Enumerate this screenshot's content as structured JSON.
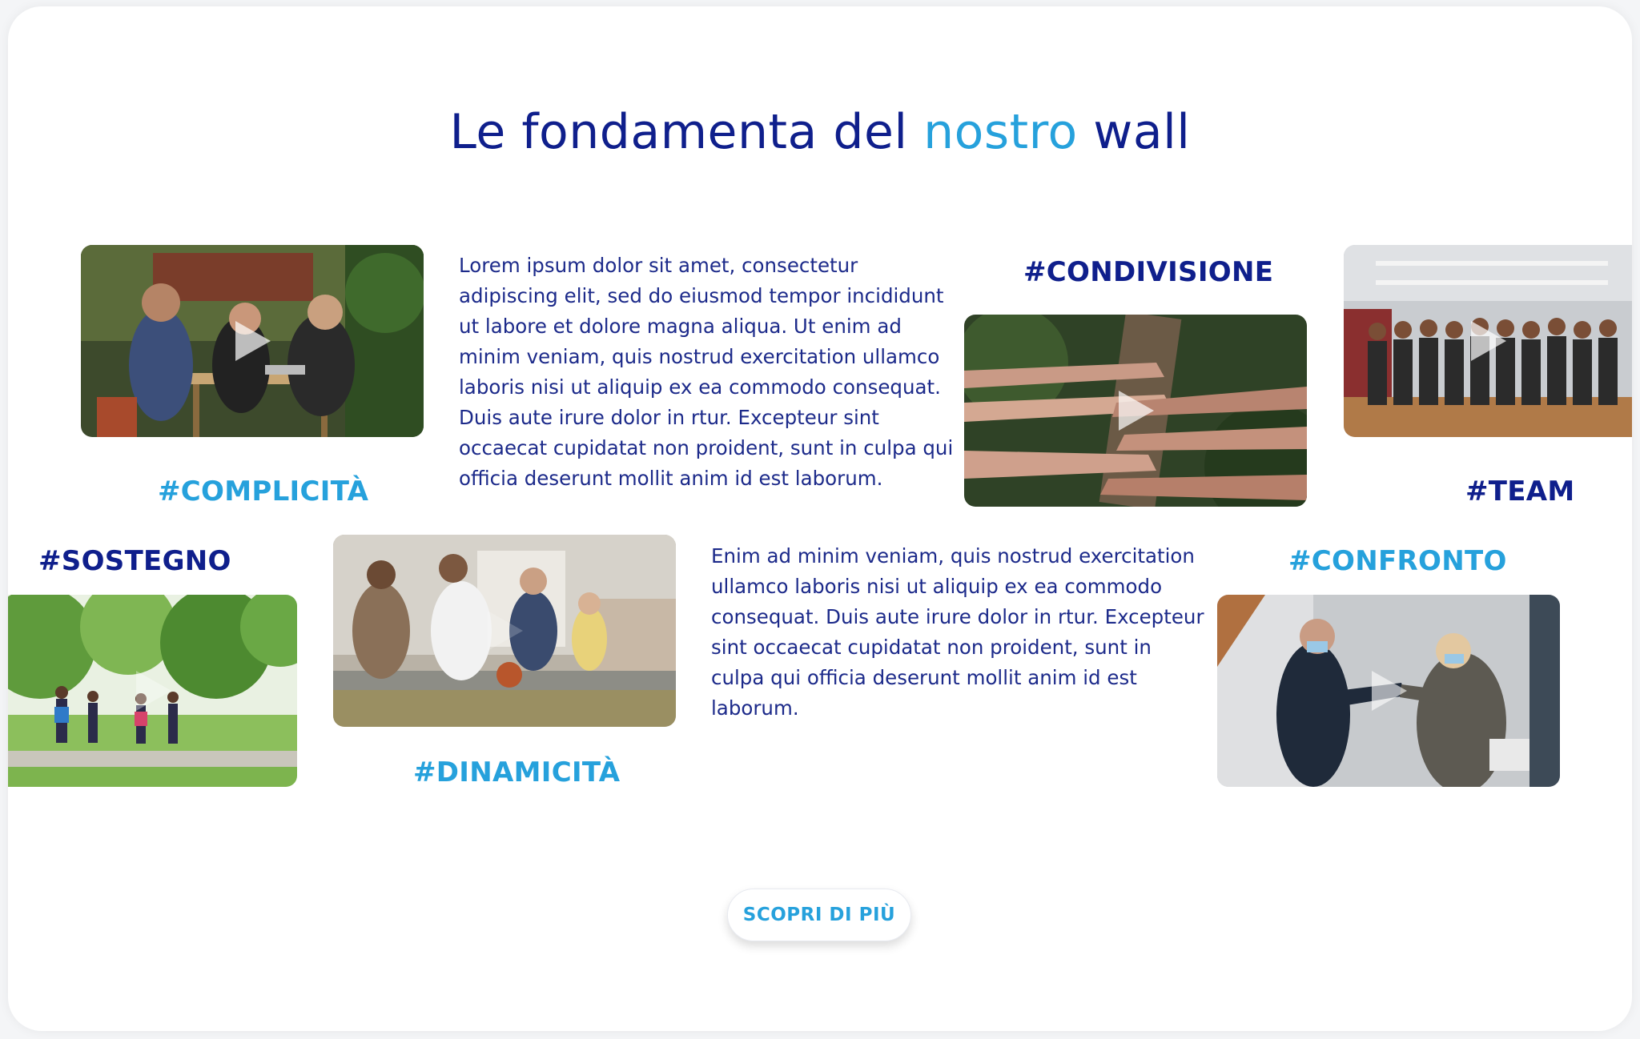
{
  "section": {
    "title_part1": "Le fondamenta del ",
    "title_accent": "nostro",
    "title_part2": " wall"
  },
  "tags": {
    "complicita": "#COMPLICITÀ",
    "condivisione": "#CONDIVISIONE",
    "team": "#TEAM",
    "sostegno": "#SOSTEGNO",
    "dinamicita": "#DINAMICITÀ",
    "confronto": "#CONFRONTO"
  },
  "paragraphs": {
    "first": [
      "Lorem ipsum dolor sit amet, consectetur",
      "adipiscing elit, sed do eiusmod tempor incididunt",
      "ut labore et dolore magna aliqua. Ut enim ad",
      "minim veniam, quis nostrud exercitation ullamco",
      "laboris nisi ut aliquip ex ea commodo consequat.",
      "Duis aute irure dolor in rtur.  Excepteur sint",
      "occaecat cupidatat non proident, sunt in culpa qui",
      "officia deserunt mollit anim id est laborum."
    ],
    "second": [
      "Enim ad minim veniam, quis nostrud exercitation",
      "ullamco laboris nisi ut aliquip ex ea commodo",
      "consequat. Duis aute irure dolor in rtur.  Excepteur",
      "sint occaecat cupidatat non proident, sunt in",
      "culpa qui officia deserunt mollit anim id est",
      "laborum."
    ]
  },
  "cta": {
    "label": "SCOPRI DI PIÙ"
  },
  "colors": {
    "navy": "#0f1f8c",
    "accent": "#26a1dc",
    "text": "#1c2a8a"
  },
  "icons": {
    "video_overlay": "play-icon"
  }
}
